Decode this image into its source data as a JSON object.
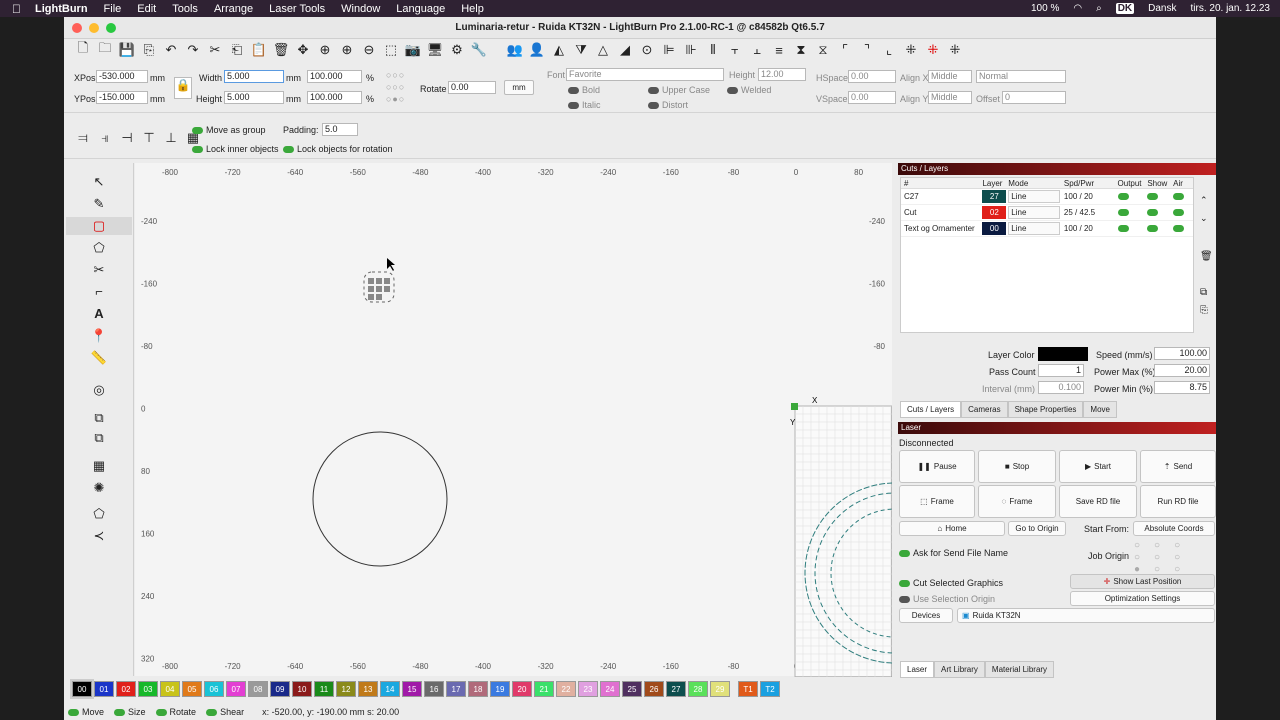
{
  "menubar": {
    "app": "LightBurn",
    "items": [
      "File",
      "Edit",
      "Tools",
      "Arrange",
      "Laser Tools",
      "Window",
      "Language",
      "Help"
    ],
    "battery": "100 %",
    "keyboard": "DK",
    "lang": "Dansk",
    "datetime": "tirs. 20. jan. 12.23"
  },
  "window": {
    "title": "Luminaria-retur - Ruida KT32N - LightBurn Pro 2.1.00-RC-1 @ c84582b Qt6.5.7"
  },
  "numeric": {
    "xpos_label": "XPos",
    "xpos": "-530.000",
    "ypos_label": "YPos",
    "ypos": "-150.000",
    "unit": "mm",
    "width_label": "Width",
    "width": "5.000",
    "height_label": "Height",
    "height": "5.000",
    "wpct": "100.000",
    "hpct": "100.000",
    "pct": "%",
    "rotate_label": "Rotate",
    "rotate": "0.00",
    "mm_btn": "mm"
  },
  "text": {
    "font_label": "Font",
    "font": "Favorite",
    "height_label": "Height",
    "height": "12.00",
    "hspace_label": "HSpace",
    "hspace": "0.00",
    "vspace_label": "VSpace",
    "vspace": "0.00",
    "alignx_label": "Align X",
    "alignx": "Middle",
    "aligny_label": "Align Y",
    "aligny": "Middle",
    "style": "Normal",
    "offset_label": "Offset",
    "offset": "0",
    "bold": "Bold",
    "italic": "Italic",
    "upper": "Upper Case",
    "distort": "Distort",
    "welded": "Welded"
  },
  "arrange": {
    "move_group": "Move as group",
    "padding_label": "Padding:",
    "padding": "5.0",
    "lock_inner": "Lock inner objects",
    "lock_rot": "Lock objects for rotation"
  },
  "ruler": {
    "x": [
      "-800",
      "-720",
      "-640",
      "-560",
      "-480",
      "-400",
      "-320",
      "-240",
      "-160",
      "-80",
      "0",
      "80"
    ],
    "y": [
      "-240",
      "-160",
      "-80",
      "0",
      "80",
      "160",
      "240",
      "320"
    ]
  },
  "cuts": {
    "title": "Cuts / Layers",
    "headers": [
      "#",
      "Layer",
      "Mode",
      "Spd/Pwr",
      "Output",
      "Show",
      "Air"
    ],
    "rows": [
      {
        "name": "C27",
        "layer": "27",
        "color": "#0d4d4d",
        "mode": "Line",
        "sp": "100 / 20"
      },
      {
        "name": "Cut",
        "layer": "02",
        "color": "#e0201a",
        "mode": "Line",
        "sp": "25 / 42.5"
      },
      {
        "name": "Text og Ornamenter",
        "layer": "00",
        "color": "#0a1a40",
        "mode": "Line",
        "sp": "100 / 20"
      }
    ],
    "layer_color": "Layer Color",
    "speed_label": "Speed (mm/s)",
    "speed": "100.00",
    "pass_label": "Pass Count",
    "pass": "1",
    "pmax_label": "Power Max (%)",
    "pmax": "20.00",
    "interval_label": "Interval (mm)",
    "interval": "0.100",
    "pmin_label": "Power Min (%)",
    "pmin": "8.75",
    "tabs": [
      "Cuts / Layers",
      "Cameras",
      "Shape Properties",
      "Move"
    ]
  },
  "laser": {
    "title": "Laser",
    "status": "Disconnected",
    "pause": "Pause",
    "stop": "Stop",
    "start": "Start",
    "send": "Send",
    "frame1": "Frame",
    "frame2": "Frame",
    "save_rd": "Save RD file",
    "run_rd": "Run RD file",
    "home": "Home",
    "origin": "Go to Origin",
    "start_from_label": "Start From:",
    "start_from": "Absolute Coords",
    "ask_send": "Ask for Send File Name",
    "job_origin": "Job Origin",
    "cut_sel": "Cut Selected Graphics",
    "use_sel": "Use Selection Origin",
    "show_last": "Show Last Position",
    "opt": "Optimization Settings",
    "devices": "Devices",
    "device": "Ruida KT32N",
    "tabs": [
      "Laser",
      "Art Library",
      "Material Library"
    ]
  },
  "palette": [
    {
      "n": "00",
      "c": "#000000"
    },
    {
      "n": "01",
      "c": "#1a35c8"
    },
    {
      "n": "02",
      "c": "#e0201a"
    },
    {
      "n": "03",
      "c": "#17b82a"
    },
    {
      "n": "04",
      "c": "#c8c31a"
    },
    {
      "n": "05",
      "c": "#e07a1a"
    },
    {
      "n": "06",
      "c": "#19c3d6"
    },
    {
      "n": "07",
      "c": "#e33fd3"
    },
    {
      "n": "08",
      "c": "#9a9a9a"
    },
    {
      "n": "09",
      "c": "#1a2a8a"
    },
    {
      "n": "10",
      "c": "#8a1a1a"
    },
    {
      "n": "11",
      "c": "#1a8a1a"
    },
    {
      "n": "12",
      "c": "#8a8a1a"
    },
    {
      "n": "13",
      "c": "#c07a1a"
    },
    {
      "n": "14",
      "c": "#1aa8e0"
    },
    {
      "n": "15",
      "c": "#a01aa8"
    },
    {
      "n": "16",
      "c": "#6a6a6a"
    },
    {
      "n": "17",
      "c": "#6a6ab0"
    },
    {
      "n": "18",
      "c": "#b06a7a"
    },
    {
      "n": "19",
      "c": "#3a7ae0"
    },
    {
      "n": "20",
      "c": "#e03a6a"
    },
    {
      "n": "21",
      "c": "#3ae06a"
    },
    {
      "n": "22",
      "c": "#e0b0a0"
    },
    {
      "n": "23",
      "c": "#e0a0e0"
    },
    {
      "n": "24",
      "c": "#e070d0"
    },
    {
      "n": "25",
      "c": "#503060"
    },
    {
      "n": "26",
      "c": "#a04a1a"
    },
    {
      "n": "27",
      "c": "#0d4d4d"
    },
    {
      "n": "28",
      "c": "#5ae05a"
    },
    {
      "n": "29",
      "c": "#e0e07a"
    },
    {
      "n": "T1",
      "c": "#e05a1a"
    },
    {
      "n": "T2",
      "c": "#1aa0e0"
    }
  ],
  "status": {
    "move": "Move",
    "size": "Size",
    "rotate": "Rotate",
    "shear": "Shear",
    "coords": "x: -520.00, y: -190.00 mm  s: 20.00"
  }
}
